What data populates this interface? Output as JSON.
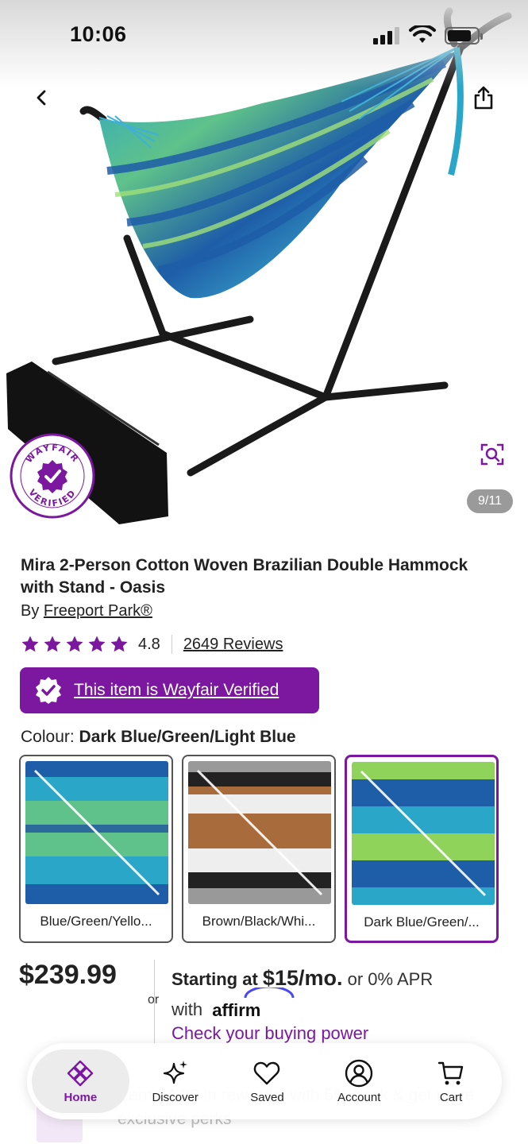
{
  "status_bar": {
    "time": "10:06"
  },
  "gallery": {
    "counter": "9/11",
    "seal_top_text": "WAYFAIR",
    "seal_bottom_text": "VERIFIED"
  },
  "product": {
    "title": "Mira 2-Person Cotton Woven Brazilian Double Hammock with Stand - Oasis",
    "by_prefix": "By",
    "brand": "Freeport Park®",
    "rating": "4.8",
    "reviews": "2649 Reviews",
    "verified_banner": "This item is Wayfair Verified",
    "colour_label": "Colour:",
    "colour_value": "Dark Blue/Green/Light Blue",
    "swatches": [
      {
        "label": "Blue/Green/Yello..."
      },
      {
        "label": "Brown/Black/Whi..."
      },
      {
        "label": "Dark Blue/Green/..."
      }
    ],
    "price": "$239.99",
    "price_or": "or",
    "financing_prefix": "Starting at",
    "financing_amount": "$15/mo.",
    "financing_suffix": "or 0% APR",
    "financing_with": "with",
    "affirm": "affirm",
    "buying_power": "Check your buying power"
  },
  "promo": {
    "text": "Earn $4.80 in rewards, with 5% back & get more exclusive perks"
  },
  "colors": {
    "brand_purple": "#7b189f",
    "counter_bg": "#9a9a9a"
  },
  "bottom_nav": {
    "items": [
      {
        "label": "Home",
        "icon": "home-icon"
      },
      {
        "label": "Discover",
        "icon": "sparkle-icon"
      },
      {
        "label": "Saved",
        "icon": "heart-icon"
      },
      {
        "label": "Account",
        "icon": "account-icon"
      },
      {
        "label": "Cart",
        "icon": "cart-icon"
      }
    ]
  }
}
